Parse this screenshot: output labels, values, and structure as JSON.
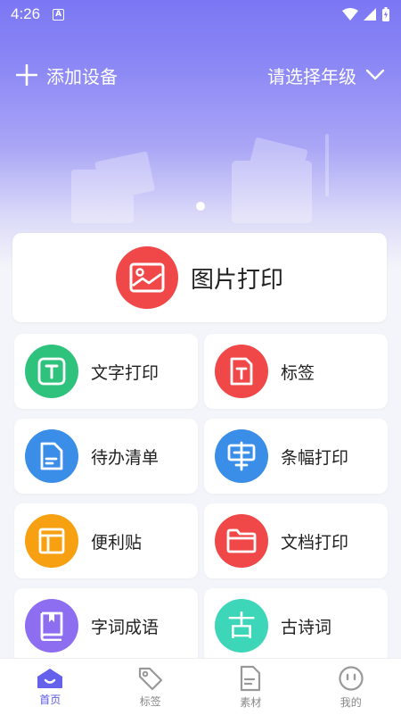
{
  "status": {
    "time": "4:26",
    "notification_icon": "A"
  },
  "topbar": {
    "add_device": "添加设备",
    "grade_select": "请选择年级"
  },
  "main_card": {
    "label": "图片打印",
    "color": "#f04848",
    "icon": "image-icon"
  },
  "grid": [
    {
      "label": "文字打印",
      "color": "#2fc27c",
      "icon": "text-icon"
    },
    {
      "label": "标签",
      "color": "#f04848",
      "icon": "label-icon"
    },
    {
      "label": "待办清单",
      "color": "#3a8ee8",
      "icon": "todo-icon"
    },
    {
      "label": "条幅打印",
      "color": "#3a8ee8",
      "icon": "banner-icon"
    },
    {
      "label": "便利贴",
      "color": "#f7a012",
      "icon": "sticky-note-icon"
    },
    {
      "label": "文档打印",
      "color": "#f04848",
      "icon": "folder-icon"
    },
    {
      "label": "字词成语",
      "color": "#8e6ef0",
      "icon": "book-icon"
    },
    {
      "label": "古诗词",
      "color": "#3ed6b8",
      "icon": "ancient-poem-icon",
      "glyph": "古"
    }
  ],
  "tabs": [
    {
      "label": "首页",
      "active": true,
      "icon": "home-icon"
    },
    {
      "label": "标签",
      "active": false,
      "icon": "tag-icon"
    },
    {
      "label": "素材",
      "active": false,
      "icon": "material-icon"
    },
    {
      "label": "我的",
      "active": false,
      "icon": "profile-icon"
    }
  ],
  "colors": {
    "accent": "#5b57e6",
    "hero_top": "#7b77f4",
    "background": "#f4f5fa"
  }
}
